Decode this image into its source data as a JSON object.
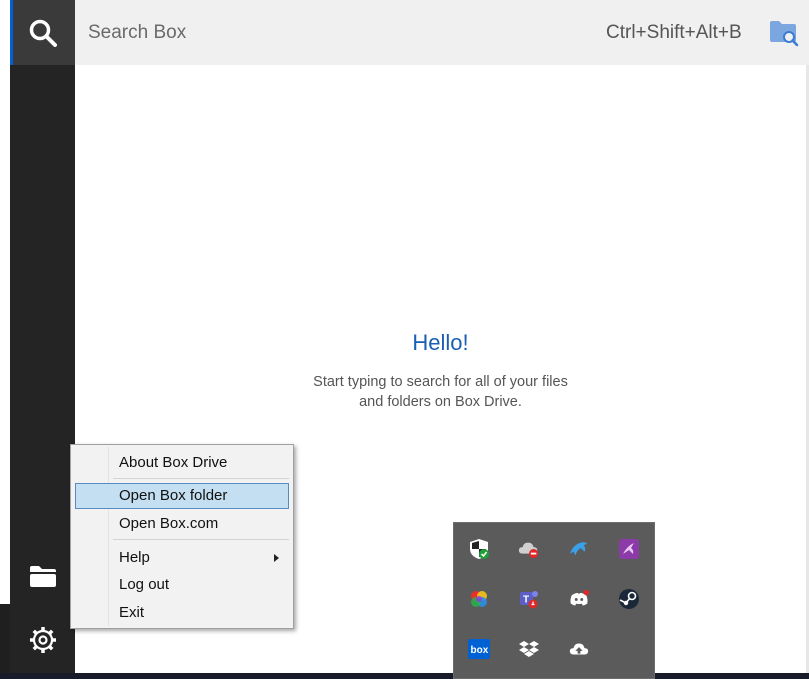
{
  "search": {
    "placeholder": "Search Box",
    "shortcut": "Ctrl+Shift+Alt+B"
  },
  "main": {
    "greeting": "Hello!",
    "instructions_line1": "Start typing to search for all of your files",
    "instructions_line2": "and folders on Box Drive."
  },
  "context_menu": {
    "items": [
      {
        "label": "About Box Drive"
      },
      {
        "label": "Open Box folder",
        "highlighted": true
      },
      {
        "label": "Open Box.com"
      },
      {
        "label": "Help",
        "has_submenu": true
      },
      {
        "label": "Log out"
      },
      {
        "label": "Exit"
      }
    ]
  },
  "sidebar": {
    "icons": [
      "search-icon",
      "folder-icon",
      "settings-icon"
    ]
  },
  "tray": {
    "icons": [
      "windows-security-icon",
      "onedrive-error-icon",
      "dolphin-icon",
      "purple-app-icon",
      "color-wheel-icon",
      "teams-icon",
      "discord-icon",
      "steam-icon",
      "box-icon",
      "dropbox-icon",
      "cloud-upload-icon"
    ],
    "box_label": "box"
  },
  "colors": {
    "accent": "#0061d5",
    "sidebar_bg": "#242424",
    "greeting": "#1a5fb4",
    "menu_highlight": "#c4dff1"
  }
}
